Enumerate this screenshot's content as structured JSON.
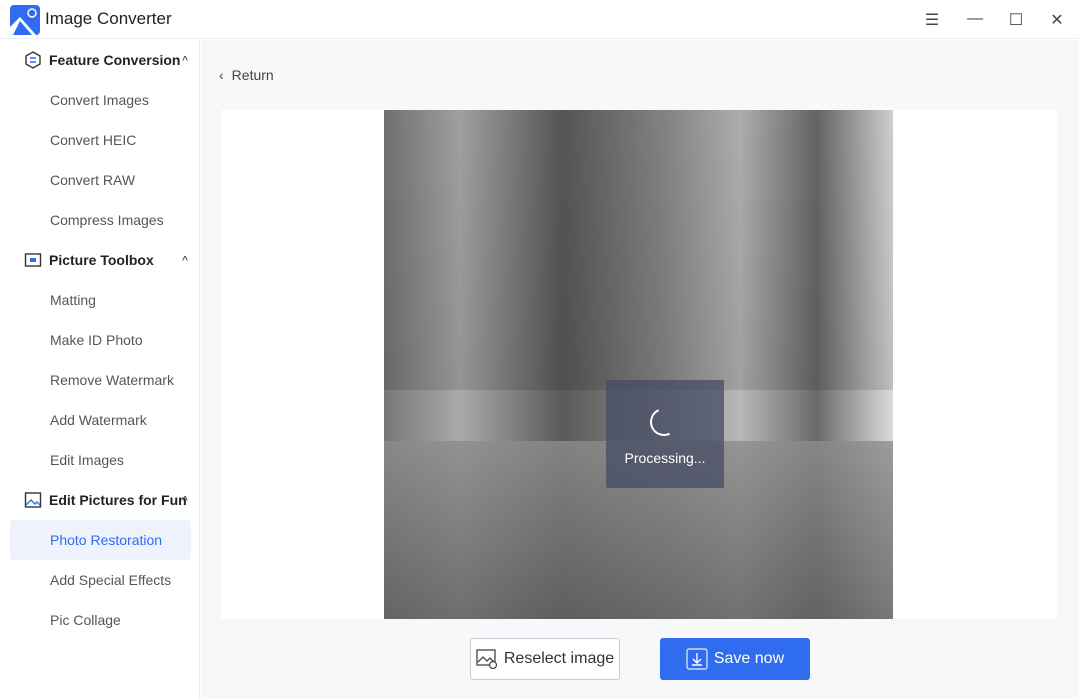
{
  "app": {
    "title": "Image Converter"
  },
  "window": {
    "menu_icon": "hamburger-icon",
    "minimize_icon": "minimize-icon",
    "maximize_icon": "maximize-icon",
    "close_icon": "close-icon"
  },
  "sidebar": {
    "groups": [
      {
        "label": "Feature Conversion",
        "icon": "convert-hexagon-icon",
        "items": [
          "Convert Images",
          "Convert HEIC",
          "Convert RAW",
          "Compress Images"
        ]
      },
      {
        "label": "Picture Toolbox",
        "icon": "toolbox-icon",
        "items": [
          "Matting",
          "Make ID Photo",
          "Remove Watermark",
          "Add Watermark",
          "Edit Images"
        ]
      },
      {
        "label": "Edit Pictures for Fun",
        "icon": "picture-icon",
        "items": [
          "Photo Restoration",
          "Add Special Effects",
          "Pic Collage"
        ]
      }
    ],
    "active_item": "Photo Restoration"
  },
  "main": {
    "return_label": "Return",
    "processing_label": "Processing...",
    "reselect_label": "Reselect image",
    "save_label": "Save now",
    "accent": "#2f6cf0"
  }
}
